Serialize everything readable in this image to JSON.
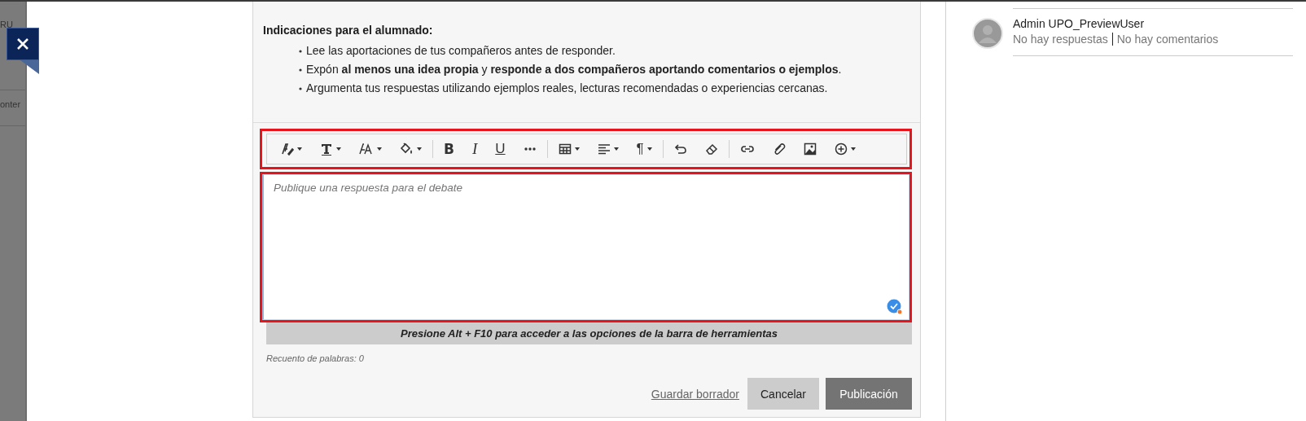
{
  "background_page": {
    "fragments": [
      "RU",
      "onter"
    ]
  },
  "instructions": {
    "heading": "Indicaciones para el alumnado:",
    "items": [
      "Lee las aportaciones de tus compañeros antes de responder.",
      "Expón **al menos una idea propia** y **responde a dos compañeros aportando comentarios o ejemplos**.",
      "Argumenta tus respuestas utilizando ejemplos reales, lecturas recomendadas o experiencias cercanas."
    ]
  },
  "toolbar": [
    {
      "kind": "icon",
      "dropdown": true
    },
    {
      "kind": "icon",
      "dropdown": true
    },
    {
      "kind": "icon",
      "dropdown": true
    },
    {
      "kind": "icon",
      "dropdown": true
    },
    {
      "kind": "separator"
    },
    {
      "kind": "glyph",
      "text": "B",
      "dropdown": false
    },
    {
      "kind": "glyph",
      "text": "I",
      "dropdown": false
    },
    {
      "kind": "glyph",
      "text": "U",
      "dropdown": false
    },
    {
      "kind": "icon",
      "dropdown": false
    },
    {
      "kind": "separator"
    },
    {
      "kind": "icon",
      "dropdown": true
    },
    {
      "kind": "icon",
      "dropdown": true
    },
    {
      "kind": "glyph",
      "text": "¶",
      "dropdown": true
    },
    {
      "kind": "separator"
    },
    {
      "kind": "icon",
      "dropdown": false
    },
    {
      "kind": "icon",
      "dropdown": false
    },
    {
      "kind": "separator"
    },
    {
      "kind": "icon",
      "dropdown": false
    },
    {
      "kind": "icon",
      "dropdown": false
    },
    {
      "kind": "icon",
      "dropdown": false
    },
    {
      "kind": "icon",
      "dropdown": true
    }
  ],
  "editor": {
    "placeholder": "Publique una respuesta para el debate"
  },
  "hint": "Presione Alt + F10 para acceder a las opciones de la barra de herramientas",
  "word_count": "Recuento de palabras: 0",
  "actions": [
    {
      "kind": "link",
      "label": "Guardar borrador"
    },
    {
      "kind": "secondary",
      "label": "Cancelar"
    },
    {
      "kind": "primary",
      "label": "Publicación"
    }
  ],
  "participant": {
    "name": "Admin UPO_PreviewUser",
    "replies": "No hay respuestas",
    "comments": "No hay comentarios"
  }
}
